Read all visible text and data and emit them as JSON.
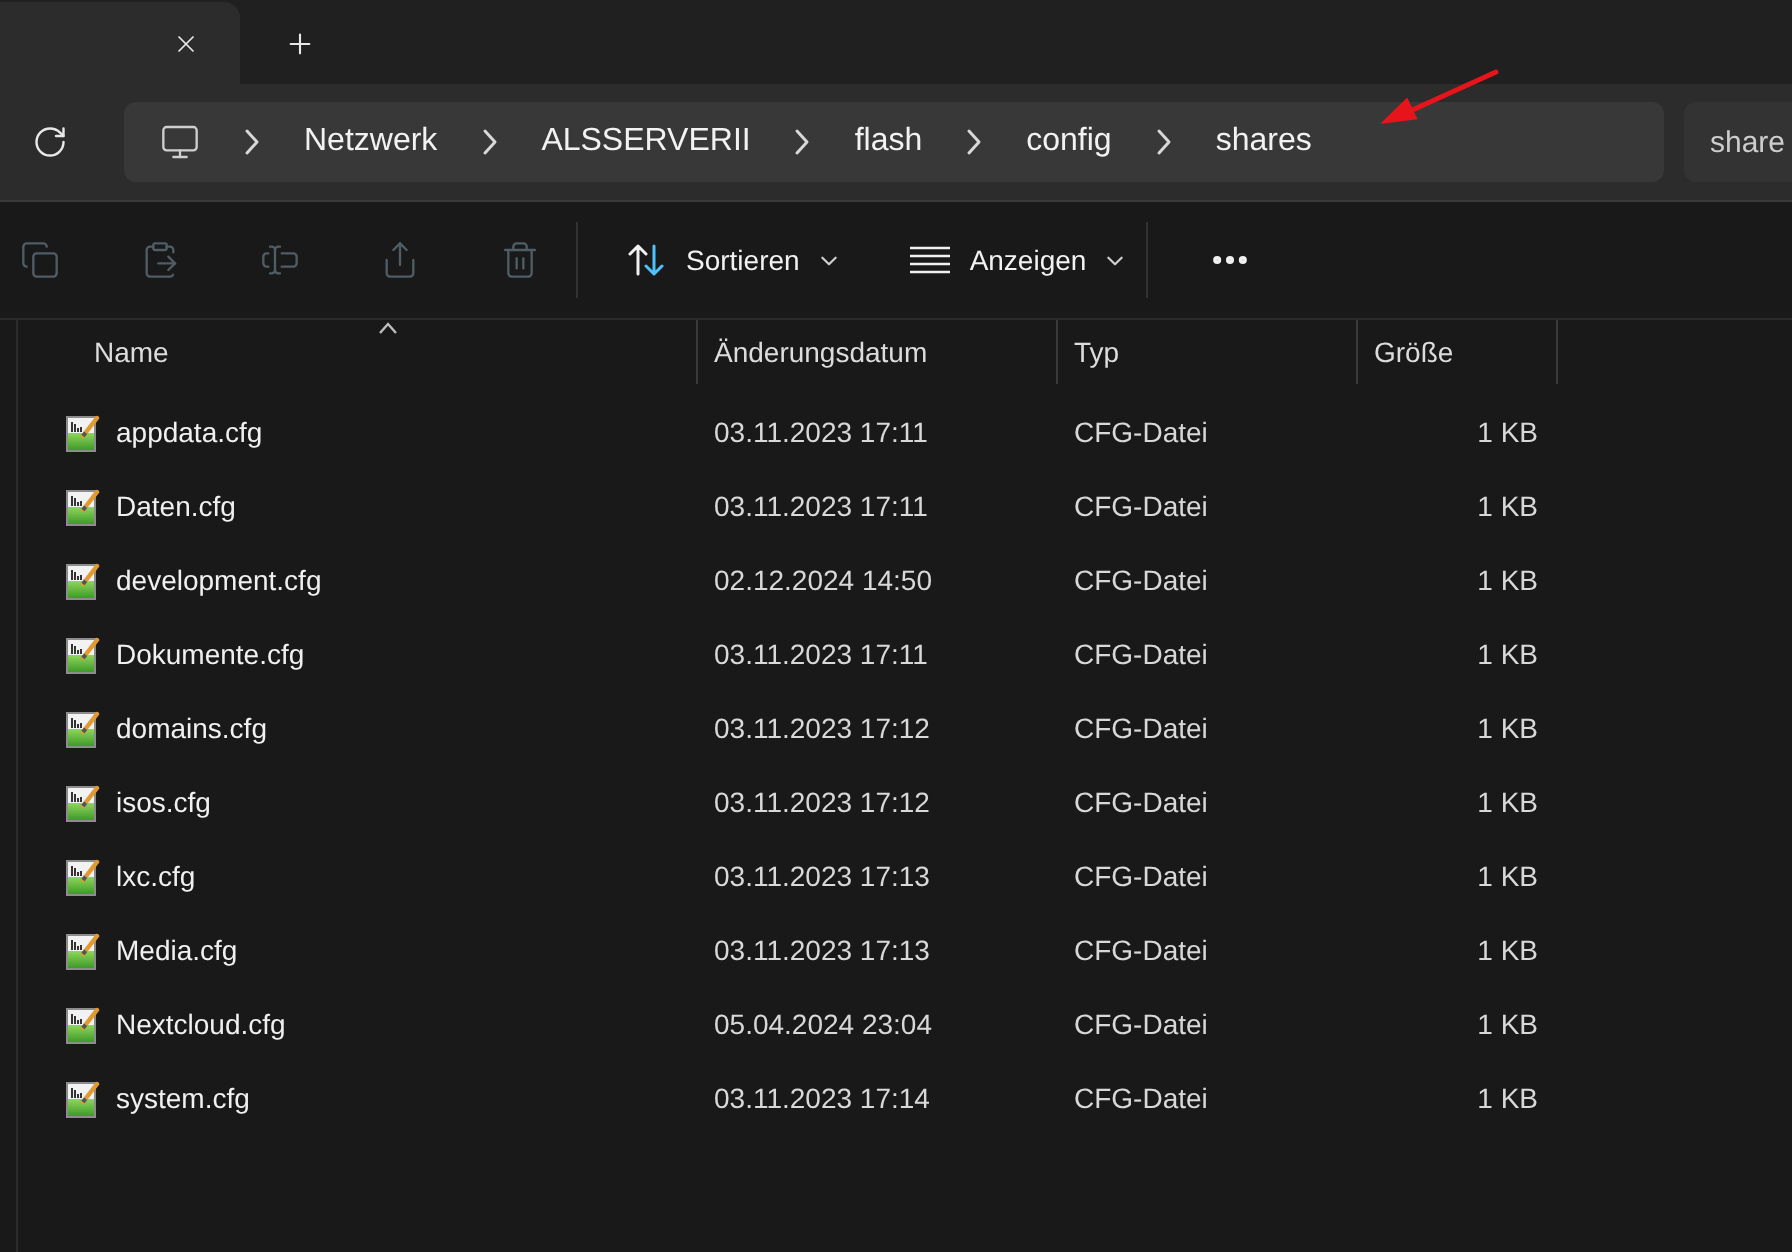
{
  "tabs": [
    {
      "selected": true
    }
  ],
  "address_bar": {
    "segments": [
      "Netzwerk",
      "ALSSERVERII",
      "flash",
      "config",
      "shares"
    ]
  },
  "search": {
    "placeholder": "share"
  },
  "toolbar": {
    "actions": [
      {
        "kind": "copy",
        "disabled": true
      },
      {
        "kind": "paste",
        "disabled": true
      },
      {
        "kind": "rename",
        "disabled": true
      },
      {
        "kind": "share",
        "disabled": true
      },
      {
        "kind": "delete",
        "disabled": true
      }
    ],
    "menus": [
      {
        "kind": "sort",
        "label": "Sortieren"
      },
      {
        "kind": "view",
        "label": "Anzeigen"
      }
    ]
  },
  "table": {
    "columns": [
      {
        "label": "Name",
        "sorted": true
      },
      {
        "label": "Änderungsdatum",
        "sorted": false
      },
      {
        "label": "Typ",
        "sorted": false
      },
      {
        "label": "Größe",
        "sorted": false
      }
    ],
    "rows": [
      {
        "name": "appdata.cfg",
        "modified": "03.11.2023 17:11",
        "type": "CFG-Datei",
        "size": "1 KB"
      },
      {
        "name": "Daten.cfg",
        "modified": "03.11.2023 17:11",
        "type": "CFG-Datei",
        "size": "1 KB"
      },
      {
        "name": "development.cfg",
        "modified": "02.12.2024 14:50",
        "type": "CFG-Datei",
        "size": "1 KB"
      },
      {
        "name": "Dokumente.cfg",
        "modified": "03.11.2023 17:11",
        "type": "CFG-Datei",
        "size": "1 KB"
      },
      {
        "name": "domains.cfg",
        "modified": "03.11.2023 17:12",
        "type": "CFG-Datei",
        "size": "1 KB"
      },
      {
        "name": "isos.cfg",
        "modified": "03.11.2023 17:12",
        "type": "CFG-Datei",
        "size": "1 KB"
      },
      {
        "name": "lxc.cfg",
        "modified": "03.11.2023 17:13",
        "type": "CFG-Datei",
        "size": "1 KB"
      },
      {
        "name": "Media.cfg",
        "modified": "03.11.2023 17:13",
        "type": "CFG-Datei",
        "size": "1 KB"
      },
      {
        "name": "Nextcloud.cfg",
        "modified": "05.04.2024 23:04",
        "type": "CFG-Datei",
        "size": "1 KB"
      },
      {
        "name": "system.cfg",
        "modified": "03.11.2023 17:14",
        "type": "CFG-Datei",
        "size": "1 KB"
      }
    ]
  }
}
